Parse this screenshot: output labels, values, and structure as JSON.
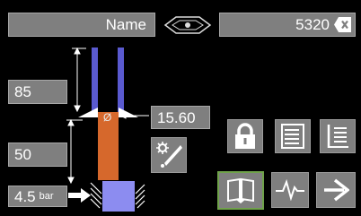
{
  "header": {
    "name_label": "Name",
    "job_value": "5320"
  },
  "fields": {
    "upper_height": "85",
    "lower_height": "50",
    "pressure_value": "4.5",
    "pressure_unit": "bar",
    "diameter": "15.60"
  },
  "diagram": {
    "symbol": "Ø"
  },
  "colors": {
    "field_bg": "#7f7f7f",
    "electrode": "#5a5ad0",
    "workpiece": "#d6682c",
    "base": "#8c8cf0",
    "active_border": "#6fa24a"
  },
  "icons": {
    "logo": "logo-icon",
    "clear": "clear-icon",
    "settings": "electrode-settings-icon",
    "lock": "lock-icon",
    "list": "list-icon",
    "program_list": "program-list-icon",
    "book": "book-icon",
    "waveform": "waveform-icon",
    "next": "arrow-right-icon"
  }
}
